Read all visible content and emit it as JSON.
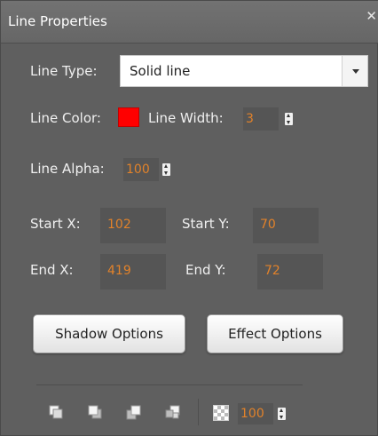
{
  "panel": {
    "title": "Line Properties",
    "close_icon": "✕"
  },
  "line_type": {
    "label": "Line Type:",
    "value": "Solid line"
  },
  "line_color": {
    "label": "Line Color:",
    "color": "#ff0000"
  },
  "line_width": {
    "label": "Line Width:",
    "value": "3"
  },
  "line_alpha": {
    "label": "Line Alpha:",
    "value": "100"
  },
  "start_x": {
    "label": "Start X:",
    "value": "102"
  },
  "start_y": {
    "label": "Start Y:",
    "value": "70"
  },
  "end_x": {
    "label": "End X:",
    "value": "419"
  },
  "end_y": {
    "label": "End Y:",
    "value": "72"
  },
  "buttons": {
    "shadow": "Shadow Options",
    "effect": "Effect Options"
  },
  "bottom_bar": {
    "icons": [
      "bring-to-front-icon",
      "bring-forward-icon",
      "send-backward-icon",
      "send-to-back-icon",
      "transparency-icon"
    ],
    "alpha_value": "100"
  },
  "colors": {
    "panel_bg": "#5f5f5f",
    "field_bg": "#555555",
    "value_text": "#e2822a"
  }
}
